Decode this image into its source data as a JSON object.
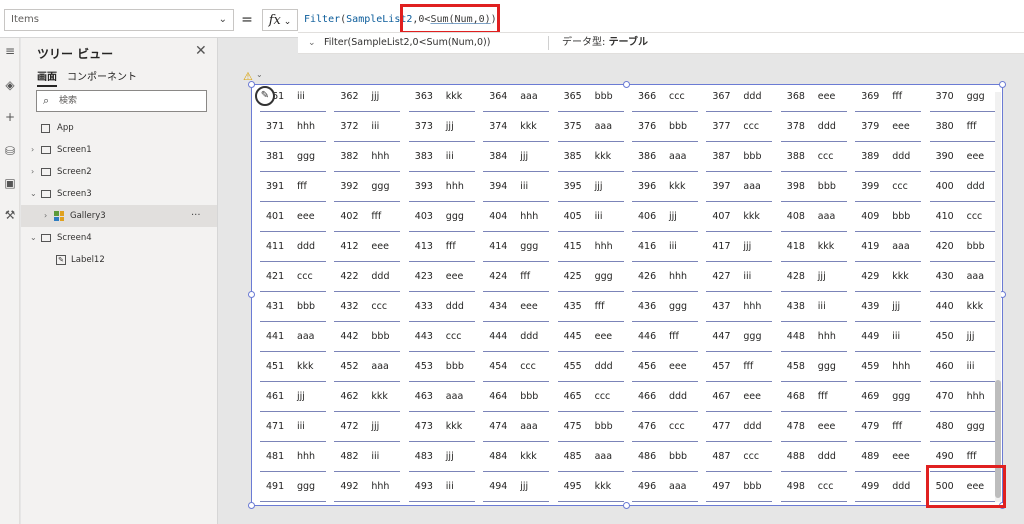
{
  "formula_bar": {
    "property": "Items",
    "equals": "=",
    "fx": "fx",
    "formula_fn": "Filter",
    "formula_open": "(",
    "formula_arg1": "SampleList2",
    "formula_rest_a": ",0<",
    "formula_sum": "Sum(Num,0)",
    "formula_close": ")",
    "hint_expr": "Filter(SampleList2,0<Sum(Num,0))",
    "hint_type_label": "データ型:",
    "hint_type_value": "テーブル"
  },
  "tree": {
    "title": "ツリー ビュー",
    "tabs": [
      "画面",
      "コンポーネント"
    ],
    "search_placeholder": "検索",
    "nodes": [
      {
        "label": "App"
      },
      {
        "label": "Screen1"
      },
      {
        "label": "Screen2"
      },
      {
        "label": "Screen3"
      },
      {
        "label": "Gallery3"
      },
      {
        "label": "Screen4"
      },
      {
        "label": "Label12"
      }
    ],
    "more": "···"
  },
  "gallery": {
    "rows": [
      [
        [
          "361",
          "iii"
        ],
        [
          "362",
          "jjj"
        ],
        [
          "363",
          "kkk"
        ],
        [
          "364",
          "aaa"
        ],
        [
          "365",
          "bbb"
        ],
        [
          "366",
          "ccc"
        ],
        [
          "367",
          "ddd"
        ],
        [
          "368",
          "eee"
        ],
        [
          "369",
          "fff"
        ],
        [
          "370",
          "ggg"
        ]
      ],
      [
        [
          "371",
          "hhh"
        ],
        [
          "372",
          "iii"
        ],
        [
          "373",
          "jjj"
        ],
        [
          "374",
          "kkk"
        ],
        [
          "375",
          "aaa"
        ],
        [
          "376",
          "bbb"
        ],
        [
          "377",
          "ccc"
        ],
        [
          "378",
          "ddd"
        ],
        [
          "379",
          "eee"
        ],
        [
          "380",
          "fff"
        ]
      ],
      [
        [
          "381",
          "ggg"
        ],
        [
          "382",
          "hhh"
        ],
        [
          "383",
          "iii"
        ],
        [
          "384",
          "jjj"
        ],
        [
          "385",
          "kkk"
        ],
        [
          "386",
          "aaa"
        ],
        [
          "387",
          "bbb"
        ],
        [
          "388",
          "ccc"
        ],
        [
          "389",
          "ddd"
        ],
        [
          "390",
          "eee"
        ]
      ],
      [
        [
          "391",
          "fff"
        ],
        [
          "392",
          "ggg"
        ],
        [
          "393",
          "hhh"
        ],
        [
          "394",
          "iii"
        ],
        [
          "395",
          "jjj"
        ],
        [
          "396",
          "kkk"
        ],
        [
          "397",
          "aaa"
        ],
        [
          "398",
          "bbb"
        ],
        [
          "399",
          "ccc"
        ],
        [
          "400",
          "ddd"
        ]
      ],
      [
        [
          "401",
          "eee"
        ],
        [
          "402",
          "fff"
        ],
        [
          "403",
          "ggg"
        ],
        [
          "404",
          "hhh"
        ],
        [
          "405",
          "iii"
        ],
        [
          "406",
          "jjj"
        ],
        [
          "407",
          "kkk"
        ],
        [
          "408",
          "aaa"
        ],
        [
          "409",
          "bbb"
        ],
        [
          "410",
          "ccc"
        ]
      ],
      [
        [
          "411",
          "ddd"
        ],
        [
          "412",
          "eee"
        ],
        [
          "413",
          "fff"
        ],
        [
          "414",
          "ggg"
        ],
        [
          "415",
          "hhh"
        ],
        [
          "416",
          "iii"
        ],
        [
          "417",
          "jjj"
        ],
        [
          "418",
          "kkk"
        ],
        [
          "419",
          "aaa"
        ],
        [
          "420",
          "bbb"
        ]
      ],
      [
        [
          "421",
          "ccc"
        ],
        [
          "422",
          "ddd"
        ],
        [
          "423",
          "eee"
        ],
        [
          "424",
          "fff"
        ],
        [
          "425",
          "ggg"
        ],
        [
          "426",
          "hhh"
        ],
        [
          "427",
          "iii"
        ],
        [
          "428",
          "jjj"
        ],
        [
          "429",
          "kkk"
        ],
        [
          "430",
          "aaa"
        ]
      ],
      [
        [
          "431",
          "bbb"
        ],
        [
          "432",
          "ccc"
        ],
        [
          "433",
          "ddd"
        ],
        [
          "434",
          "eee"
        ],
        [
          "435",
          "fff"
        ],
        [
          "436",
          "ggg"
        ],
        [
          "437",
          "hhh"
        ],
        [
          "438",
          "iii"
        ],
        [
          "439",
          "jjj"
        ],
        [
          "440",
          "kkk"
        ]
      ],
      [
        [
          "441",
          "aaa"
        ],
        [
          "442",
          "bbb"
        ],
        [
          "443",
          "ccc"
        ],
        [
          "444",
          "ddd"
        ],
        [
          "445",
          "eee"
        ],
        [
          "446",
          "fff"
        ],
        [
          "447",
          "ggg"
        ],
        [
          "448",
          "hhh"
        ],
        [
          "449",
          "iii"
        ],
        [
          "450",
          "jjj"
        ]
      ],
      [
        [
          "451",
          "kkk"
        ],
        [
          "452",
          "aaa"
        ],
        [
          "453",
          "bbb"
        ],
        [
          "454",
          "ccc"
        ],
        [
          "455",
          "ddd"
        ],
        [
          "456",
          "eee"
        ],
        [
          "457",
          "fff"
        ],
        [
          "458",
          "ggg"
        ],
        [
          "459",
          "hhh"
        ],
        [
          "460",
          "iii"
        ]
      ],
      [
        [
          "461",
          "jjj"
        ],
        [
          "462",
          "kkk"
        ],
        [
          "463",
          "aaa"
        ],
        [
          "464",
          "bbb"
        ],
        [
          "465",
          "ccc"
        ],
        [
          "466",
          "ddd"
        ],
        [
          "467",
          "eee"
        ],
        [
          "468",
          "fff"
        ],
        [
          "469",
          "ggg"
        ],
        [
          "470",
          "hhh"
        ]
      ],
      [
        [
          "471",
          "iii"
        ],
        [
          "472",
          "jjj"
        ],
        [
          "473",
          "kkk"
        ],
        [
          "474",
          "aaa"
        ],
        [
          "475",
          "bbb"
        ],
        [
          "476",
          "ccc"
        ],
        [
          "477",
          "ddd"
        ],
        [
          "478",
          "eee"
        ],
        [
          "479",
          "fff"
        ],
        [
          "480",
          "ggg"
        ]
      ],
      [
        [
          "481",
          "hhh"
        ],
        [
          "482",
          "iii"
        ],
        [
          "483",
          "jjj"
        ],
        [
          "484",
          "kkk"
        ],
        [
          "485",
          "aaa"
        ],
        [
          "486",
          "bbb"
        ],
        [
          "487",
          "ccc"
        ],
        [
          "488",
          "ddd"
        ],
        [
          "489",
          "eee"
        ],
        [
          "490",
          "fff"
        ]
      ],
      [
        [
          "491",
          "ggg"
        ],
        [
          "492",
          "hhh"
        ],
        [
          "493",
          "iii"
        ],
        [
          "494",
          "jjj"
        ],
        [
          "495",
          "kkk"
        ],
        [
          "496",
          "aaa"
        ],
        [
          "497",
          "bbb"
        ],
        [
          "498",
          "ccc"
        ],
        [
          "499",
          "ddd"
        ],
        [
          "500",
          "eee"
        ]
      ]
    ]
  },
  "icons": {
    "menu": "hamburger-icon",
    "layers": "layers-icon",
    "insert": "plus-icon",
    "data": "database-icon",
    "media": "media-icon",
    "tools": "tools-icon"
  }
}
